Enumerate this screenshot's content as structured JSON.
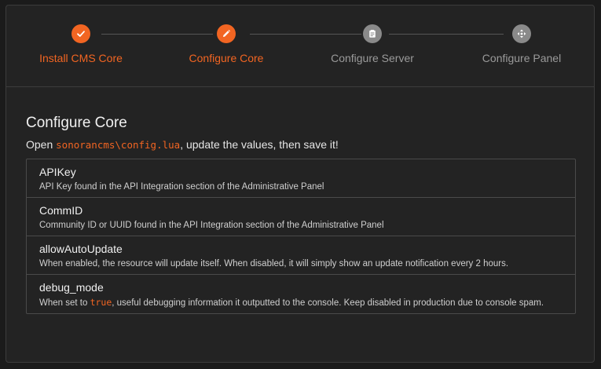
{
  "stepper": {
    "steps": [
      {
        "label": "Install CMS Core",
        "icon": "check-icon",
        "state": "completed"
      },
      {
        "label": "Configure Core",
        "icon": "pencil-icon",
        "state": "active"
      },
      {
        "label": "Configure Server",
        "icon": "clipboard-icon",
        "state": "pending"
      },
      {
        "label": "Configure Panel",
        "icon": "move-icon",
        "state": "pending"
      }
    ]
  },
  "main": {
    "title": "Configure Core",
    "subtitle": {
      "prefix": "Open ",
      "path": "sonorancms\\config.lua",
      "suffix": ", update the values, then save it!"
    },
    "config_items": [
      {
        "key": "APIKey",
        "description": "API Key found in the API Integration section of the Administrative Panel"
      },
      {
        "key": "CommID",
        "description": "Community ID or UUID found in the API Integration section of the Administrative Panel"
      },
      {
        "key": "allowAutoUpdate",
        "description": "When enabled, the resource will update itself. When disabled, it will simply show an update notification every 2 hours."
      },
      {
        "key": "debug_mode",
        "description_prefix": "When set to ",
        "description_code": "true",
        "description_suffix": ", useful debugging information it outputted to the console. Keep disabled in production due to console spam."
      }
    ]
  },
  "colors": {
    "accent": "#f26522",
    "inactive": "#8a8a8a",
    "background": "#1b1b1b",
    "panel": "#232323"
  }
}
